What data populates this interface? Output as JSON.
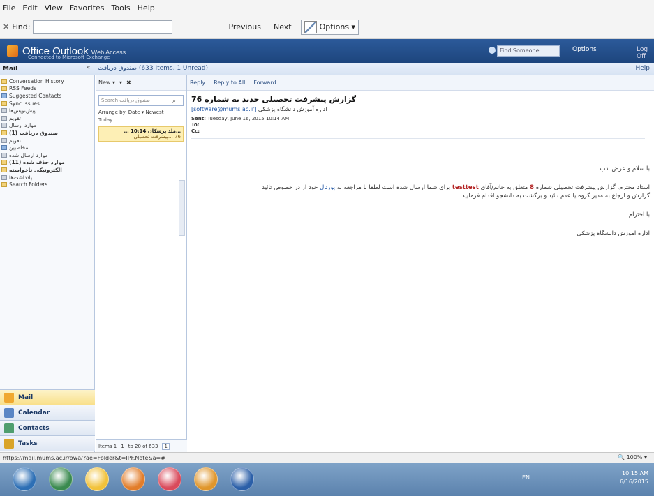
{
  "browser": {
    "menu": [
      "File",
      "Edit",
      "View",
      "Favorites",
      "Tools",
      "Help"
    ],
    "find_close": "✕",
    "find_label": "Find:",
    "find_value": "",
    "previous": "Previous",
    "next": "Next",
    "options": "Options ▾",
    "status_url": "https://mail.mums.ac.ir/owa/?ae=Folder&t=IPF.Note&a=#",
    "zoom": "🔍 100%  ▾"
  },
  "owa": {
    "title": "Office Outlook",
    "title_small": "Web Access",
    "subtitle": "Connected to Microsoft Exchange",
    "search_placeholder": "Find Someone",
    "options_label": "Options",
    "logoff_label": "Log Off"
  },
  "strip": {
    "mail": "Mail",
    "collapse": "«",
    "folderinfo": "صندوق دریافت  (633 Items, 1 Unread)",
    "help": "Help"
  },
  "tree": [
    {
      "label": "Conversation History",
      "icon": "folder",
      "bold": false
    },
    {
      "label": "RSS Feeds",
      "icon": "folder",
      "bold": false
    },
    {
      "label": "Suggested Contacts",
      "icon": "contacts",
      "bold": false
    },
    {
      "label": "Sync Issues",
      "icon": "folder",
      "bold": false
    },
    {
      "label": "پیش‌نویس‌ها",
      "icon": "gray",
      "bold": false
    },
    {
      "label": "تقویم",
      "icon": "gray",
      "bold": false
    },
    {
      "label": "موارد ارسال",
      "icon": "gray",
      "bold": false
    },
    {
      "label": "صندوق دریافت (1)",
      "icon": "folder",
      "bold": true
    },
    {
      "label": "تقویم",
      "icon": "gray",
      "bold": false
    },
    {
      "label": "مخاطبین",
      "icon": "contacts",
      "bold": false
    },
    {
      "label": "موارد ارسال شده",
      "icon": "gray",
      "bold": false
    },
    {
      "label": "موارد حذف شده (11)",
      "icon": "folder",
      "bold": true
    },
    {
      "label": "الکترونیکی ناخواسته",
      "icon": "folder",
      "bold": true
    },
    {
      "label": "یادداشت‌ها",
      "icon": "gray",
      "bold": false
    },
    {
      "label": "Search Folders",
      "icon": "folder",
      "bold": false
    }
  ],
  "navbuttons": [
    {
      "label": "Mail",
      "active": true,
      "color": "#f0a830"
    },
    {
      "label": "Calendar",
      "active": false,
      "color": "#5a86c5"
    },
    {
      "label": "Contacts",
      "active": false,
      "color": "#4f9e6e"
    },
    {
      "label": "Tasks",
      "active": false,
      "color": "#d9a429"
    }
  ],
  "list": {
    "toolbar_new": "New ▾",
    "toolbar_move": "▾",
    "search_placeholder": "Search صندوق دریافت",
    "arrange": "Arrange by: Date ▾   Newest",
    "today": "Today",
    "item_line1": "…ملد پرسکان  10:14 …",
    "item_line2": "76 …پیشرفت تحصیلی",
    "footer_items": "Items 1",
    "footer_page": "1",
    "footer_of": "to 20 of 633",
    "footer_end": "1"
  },
  "reading": {
    "reply": "Reply",
    "reply_all": "Reply to All",
    "forward": "Forward",
    "subject": "گزارش پیشرفت تحصیلی جدید به شماره 76",
    "from_name": "اداره آموزش دانشگاه پزشکی",
    "from_addr": "[software@mums.ac.ir]",
    "sent_label": "Sent:",
    "sent_value": "Tuesday, June 16, 2015 10:14 AM",
    "to_label": "To:",
    "to_value": "",
    "cc_label": "Cc:",
    "cc_value": ""
  },
  "body": {
    "greeting": "با سلام و عرض ادب",
    "line1_a": "استاد محترم، گزارش پیشرفت تحصیلی شماره",
    "line1_num": "8",
    "line1_b": "متعلق به خانم/آقای",
    "line1_name": "testtest",
    "line1_c": "برای شما ارسال شده است لطفا با مراجعه به",
    "line1_link": "پورتال",
    "line1_d": "خود از در خصوص تائید",
    "line2": "گزارش و ارجاع به مدیر گروه یا عدم تائید و برگشت به دانشجو اقدام فرمایید.",
    "regards": "با احترام",
    "signature": "اداره آموزش دانشگاه پزشکی"
  },
  "taskbar": {
    "lang": "EN",
    "time": "10:15 AM",
    "date": "6/16/2015",
    "icon_colors": [
      "#2d6fb5",
      "#3a8a4f",
      "#f2c23a",
      "#e27d2a",
      "#d94a5b",
      "#e0962b",
      "#2b5fa8"
    ]
  }
}
